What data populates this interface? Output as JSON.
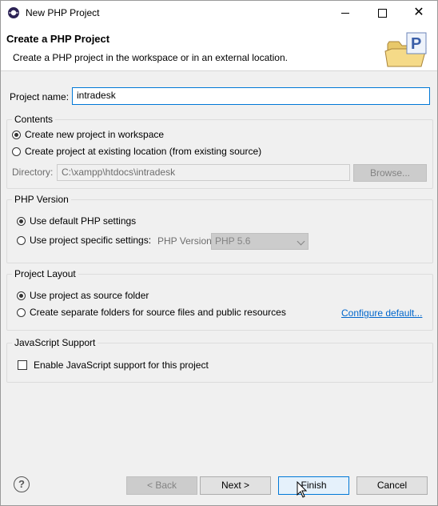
{
  "window": {
    "title": "New PHP Project",
    "controls": {
      "minimize": "",
      "maximize": "",
      "close": "✕"
    }
  },
  "banner": {
    "title": "Create a PHP Project",
    "description": "Create a PHP project in the workspace or in an external location.",
    "icon": "php-project-folder-icon"
  },
  "project_name": {
    "label": "Project name:",
    "value": "intradesk"
  },
  "contents": {
    "title": "Contents",
    "options": [
      {
        "label": "Create new project in workspace",
        "checked": true
      },
      {
        "label": "Create project at existing location (from existing source)",
        "checked": false
      }
    ],
    "directory_label": "Directory:",
    "directory_value": "C:\\xampp\\htdocs\\intradesk",
    "browse_label": "Browse..."
  },
  "php_version": {
    "title": "PHP Version",
    "options": [
      {
        "label": "Use default PHP settings",
        "checked": true
      },
      {
        "label": "Use project specific settings:",
        "checked": false
      }
    ],
    "version_label": "PHP Version:",
    "version_value": "PHP 5.6"
  },
  "project_layout": {
    "title": "Project Layout",
    "options": [
      {
        "label": "Use project as source folder",
        "checked": true
      },
      {
        "label": "Create separate folders for source files and public resources",
        "checked": false
      }
    ],
    "configure_link": "Configure default..."
  },
  "javascript": {
    "title": "JavaScript Support",
    "checkbox_label": "Enable JavaScript support for this project",
    "checked": false
  },
  "footer": {
    "help_label": "?",
    "back_label": "< Back",
    "next_label": "Next >",
    "finish_label": "Finish",
    "cancel_label": "Cancel"
  },
  "colors": {
    "accent": "#0078d7",
    "link": "#0066cc",
    "background": "#f0f0f0"
  }
}
